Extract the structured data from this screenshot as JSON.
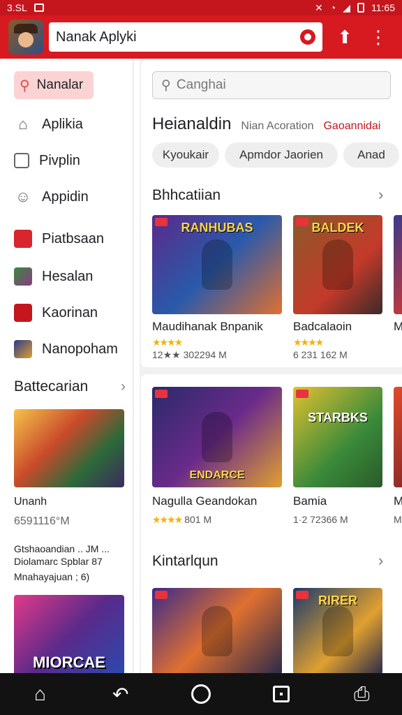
{
  "status": {
    "time": "11:65",
    "carrier": "3.SL"
  },
  "appbar": {
    "search_value": "Nanak Aplyki"
  },
  "sidebar": {
    "active": "Nanalar",
    "items": [
      "Aplikia",
      "Pivplin",
      "Appidin",
      "Piatbsaan",
      "Hesalan",
      "Kaorinan",
      "Nanopoham"
    ],
    "section_title": "Battecarian",
    "card1_title": "Unanh",
    "card1_meta": "6591116°M",
    "desc_line1": "Gtshaoandian .. JM ...",
    "desc_line2": "Diolamarc Spblar 87",
    "desc_line3": "Mnahayajuan ; 6)",
    "card2_brand": "MIORCAE"
  },
  "main": {
    "search_placeholder": "Canghai",
    "title": "Heianaldin",
    "subtitle1": "Nian Acoration",
    "subtitle2": "Gaoannidai",
    "chips": [
      "Kyoukair",
      "Apmdor  Jaorien",
      "Anad"
    ],
    "section1": "Bhhcatiian",
    "row1": [
      {
        "brand": "RANHUBAS",
        "title": "Maudihanak Bnpanik",
        "stars": "★★★★",
        "meta": "12★★ 302294 M"
      },
      {
        "brand": "BALDEK",
        "title": "Badcalaoin",
        "stars": "★★★★",
        "meta": "6 231 162 M"
      },
      {
        "brand": "",
        "title": "M",
        "stars": "★",
        "meta": "6"
      }
    ],
    "row2": [
      {
        "brand": "ENDARCE",
        "title": "Nagulla Geandokan",
        "stars": "★★★★",
        "meta": "801 M"
      },
      {
        "brand": "STARBKS",
        "title": "Bamia",
        "stars": "",
        "meta": "1·2 72366 M"
      },
      {
        "brand": "",
        "title": "M",
        "stars": "",
        "meta": "M"
      }
    ],
    "section2": "Kintarlqun",
    "row3": [
      {
        "brand": "",
        "title": "",
        "stars": "",
        "meta": ""
      },
      {
        "brand": "RIRER",
        "title": "",
        "stars": "",
        "meta": ""
      }
    ]
  },
  "colors": {
    "brand_red": "#d71920",
    "chip_bg": "#eeeeee",
    "nav_bg": "#121212",
    "star": "#f5b400"
  }
}
